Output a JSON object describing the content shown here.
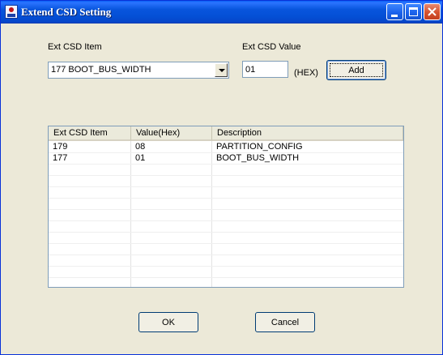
{
  "window": {
    "title": "Extend CSD Setting"
  },
  "labels": {
    "item": "Ext CSD Item",
    "value": "Ext CSD Value",
    "hex": "(HEX)"
  },
  "combo": {
    "selected": "177 BOOT_BUS_WIDTH"
  },
  "value_input": {
    "value": "01"
  },
  "buttons": {
    "add": "Add",
    "ok": "OK",
    "cancel": "Cancel"
  },
  "table": {
    "columns": [
      "Ext CSD Item",
      "Value(Hex)",
      "Description"
    ],
    "rows": [
      {
        "item": "179",
        "value": "08",
        "description": "PARTITION_CONFIG"
      },
      {
        "item": "177",
        "value": "01",
        "description": "BOOT_BUS_WIDTH"
      }
    ]
  },
  "colors": {
    "titlebar": "#0855dd",
    "face": "#ece9d8",
    "border": "#7f9db9"
  },
  "icons": {
    "app": "app-icon",
    "minimize": "minimize-icon",
    "maximize": "maximize-icon",
    "close": "close-icon",
    "dropdown": "chevron-down-icon"
  }
}
